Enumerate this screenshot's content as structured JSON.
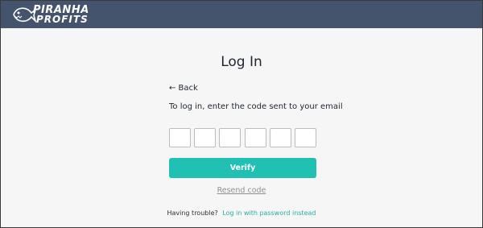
{
  "header": {
    "logo_line_1": "PIRANHA",
    "logo_line_2": "PROFITS",
    "logo_icon": "piranha-fish-icon",
    "background": "#44546c"
  },
  "main": {
    "title": "Log In",
    "back_label": "← Back",
    "instruction": "To log in, enter the code sent to your email",
    "code_digits": [
      "",
      "",
      "",
      "",
      "",
      ""
    ],
    "verify_label": "Verify",
    "resend_label": "Resend code",
    "trouble_text": "Having trouble?",
    "password_link": "Log in with password instead"
  },
  "colors": {
    "accent": "#20c0b3",
    "link": "#20b2a6",
    "text": "#1f2630",
    "muted": "#8c9196",
    "page_bg": "#f6f6f6"
  }
}
